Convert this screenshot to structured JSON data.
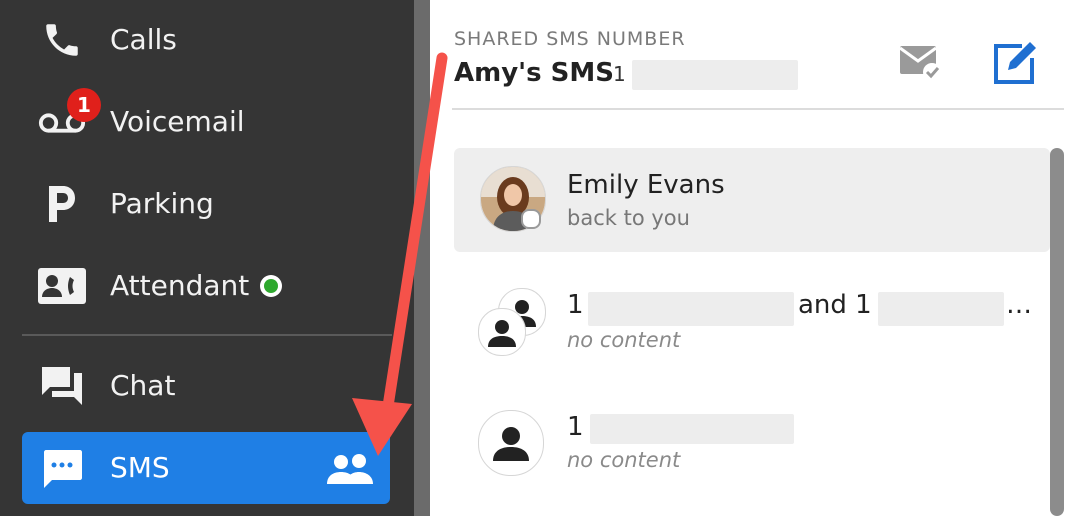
{
  "sidebar": {
    "items": [
      {
        "label": "Calls",
        "icon": "phone-icon"
      },
      {
        "label": "Voicemail",
        "icon": "voicemail-icon",
        "badge": "1"
      },
      {
        "label": "Parking",
        "icon": "parking-icon"
      },
      {
        "label": "Attendant",
        "icon": "attendant-icon",
        "status": "online"
      },
      {
        "label": "Chat",
        "icon": "chat-icon"
      },
      {
        "label": "SMS",
        "icon": "sms-icon",
        "active": true,
        "secondary_icon": "group-icon"
      }
    ]
  },
  "header": {
    "caption": "SHARED SMS NUMBER",
    "name": "Amy's SMS",
    "number_prefix": "1"
  },
  "conversations": [
    {
      "title": "Emily Evans",
      "subtitle": "back to you",
      "avatar": "photo"
    },
    {
      "title_prefix": "1",
      "title_joiner": "and 1",
      "title_ellipsis": "…",
      "subtitle": "no content",
      "avatar": "group-icon"
    },
    {
      "title_prefix": "1",
      "subtitle": "no content",
      "avatar": "person-icon"
    }
  ],
  "colors": {
    "sidebar_bg": "#353535",
    "active_item": "#1f7fe5",
    "badge": "#e0201b",
    "status_online": "#2ea82e",
    "arrow": "#f5524a",
    "compose_icon": "#1f6fd1"
  }
}
